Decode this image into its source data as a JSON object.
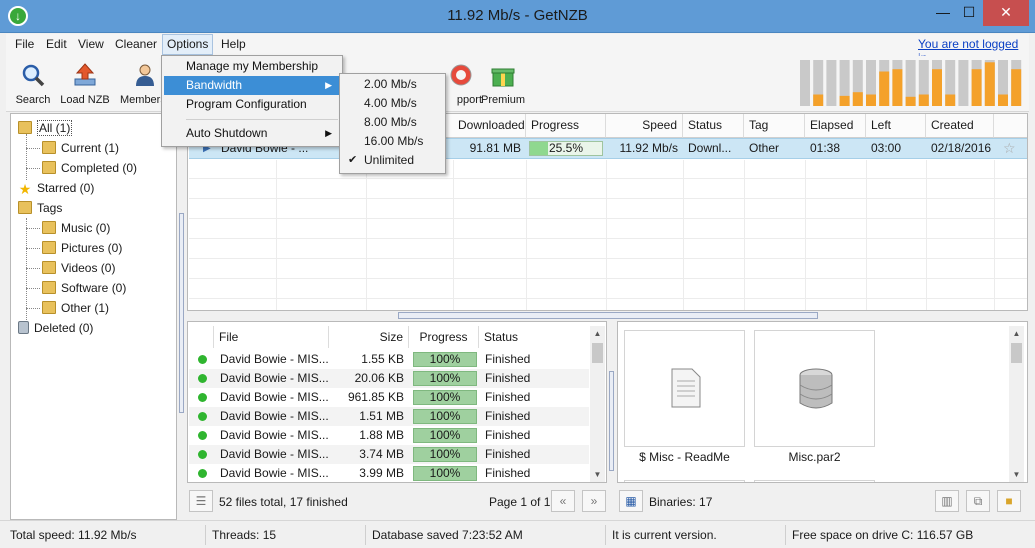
{
  "window": {
    "title": "11.92 Mb/s - GetNZB",
    "min": "—",
    "max": "☐",
    "close": "✕"
  },
  "menu": {
    "file": "File",
    "edit": "Edit",
    "view": "View",
    "cleaner": "Cleaner",
    "options": "Options",
    "help": "Help",
    "login": "You are not logged in"
  },
  "toolbar": {
    "search": "Search",
    "load_nzb": "Load NZB",
    "membership": "Members",
    "support": "pport",
    "premium": "Premium"
  },
  "tree": {
    "all": "All (1)",
    "current": "Current (1)",
    "completed": "Completed (0)",
    "starred": "Starred (0)",
    "tags": "Tags",
    "music": "Music (0)",
    "pictures": "Pictures (0)",
    "videos": "Videos (0)",
    "software": "Software (0)",
    "other": "Other (1)",
    "deleted": "Deleted (0)"
  },
  "grid": {
    "columns": {
      "downloaded": "Downloaded",
      "progress": "Progress",
      "speed": "Speed",
      "status": "Status",
      "tag": "Tag",
      "elapsed": "Elapsed",
      "left": "Left",
      "created": "Created"
    },
    "row": {
      "name": "David Bowie - ...",
      "downloaded": "91.81 MB",
      "progress": "25.5%",
      "progress_value": 25.5,
      "speed": "11.92 Mb/s",
      "status": "Downl...",
      "tag": "Other",
      "elapsed": "01:38",
      "left": "03:00",
      "created": "02/18/2016"
    }
  },
  "files": {
    "columns": {
      "file": "File",
      "size": "Size",
      "progress": "Progress",
      "status": "Status"
    },
    "rows": [
      {
        "name": "David Bowie - MIS...",
        "size": "1.55 KB",
        "progress": "100%",
        "status": "Finished"
      },
      {
        "name": "David Bowie - MIS...",
        "size": "20.06 KB",
        "progress": "100%",
        "status": "Finished"
      },
      {
        "name": "David Bowie - MIS...",
        "size": "961.85 KB",
        "progress": "100%",
        "status": "Finished"
      },
      {
        "name": "David Bowie - MIS...",
        "size": "1.51 MB",
        "progress": "100%",
        "status": "Finished"
      },
      {
        "name": "David Bowie - MIS...",
        "size": "1.88 MB",
        "progress": "100%",
        "status": "Finished"
      },
      {
        "name": "David Bowie - MIS...",
        "size": "3.74 MB",
        "progress": "100%",
        "status": "Finished"
      },
      {
        "name": "David Bowie - MIS...",
        "size": "3.99 MB",
        "progress": "100%",
        "status": "Finished"
      }
    ],
    "summary": "52 files total, 17 finished",
    "page": "Page 1 of 1",
    "prev": "«",
    "next": "»"
  },
  "binaries": {
    "items": [
      {
        "label": "$ Misc - ReadMe",
        "icon": "text-file-icon"
      },
      {
        "label": "Misc.par2",
        "icon": "database-icon"
      }
    ],
    "count": "Binaries: 17"
  },
  "statusbar": {
    "speed": "Total speed: 11.92 Mb/s",
    "threads": "Threads: 15",
    "database": "Database saved 7:23:52 AM",
    "version": "It is current version.",
    "disk": "Free space on drive C: 116.57 GB"
  },
  "options_menu": {
    "membership": "Manage my Membership",
    "bandwidth": "Bandwidth",
    "config": "Program Configuration",
    "shutdown": "Auto Shutdown",
    "arrow": "▶"
  },
  "bandwidth_menu": {
    "items": [
      "2.00 Mb/s",
      "4.00 Mb/s",
      "8.00 Mb/s",
      "16.00 Mb/s",
      "Unlimited"
    ],
    "selected": "Unlimited",
    "check": "✔"
  },
  "colors": {
    "title_bar": "#5f9bd6",
    "selection": "#3c8ed6",
    "row_highlight": "#cce6f5",
    "progress": "#9fd09f",
    "graph_fill": "#f4a12a",
    "graph_bg": "#c9c9c9"
  }
}
